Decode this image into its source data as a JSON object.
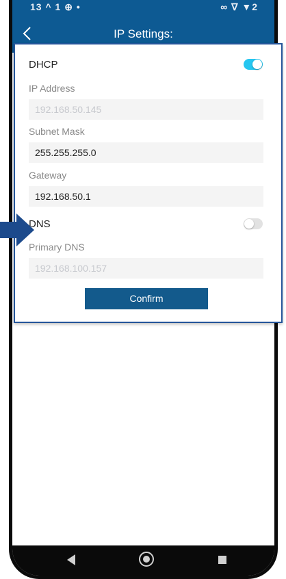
{
  "status_bar": {
    "left": "13 ^ 1 ⊕ •",
    "right": "∞ ∇ ▼2"
  },
  "header": {
    "title": "IP Settings:",
    "back_icon": "chevron-left-icon"
  },
  "dhcp": {
    "label": "DHCP",
    "enabled": true
  },
  "ip_address": {
    "label": "IP Address",
    "value": "192.168.50.145",
    "editable": false
  },
  "subnet_mask": {
    "label": "Subnet Mask",
    "value": "255.255.255.0",
    "editable": true
  },
  "gateway": {
    "label": "Gateway",
    "value": "192.168.50.1",
    "editable": true
  },
  "dns": {
    "label": "DNS",
    "enabled": false
  },
  "primary_dns": {
    "label": "Primary DNS",
    "value": "192.168.100.157",
    "editable": false
  },
  "confirm": {
    "label": "Confirm"
  },
  "colors": {
    "primary": "#0d5a93",
    "toggle_on": "#26c6f0",
    "annotation_arrow": "#1c4a8c"
  }
}
